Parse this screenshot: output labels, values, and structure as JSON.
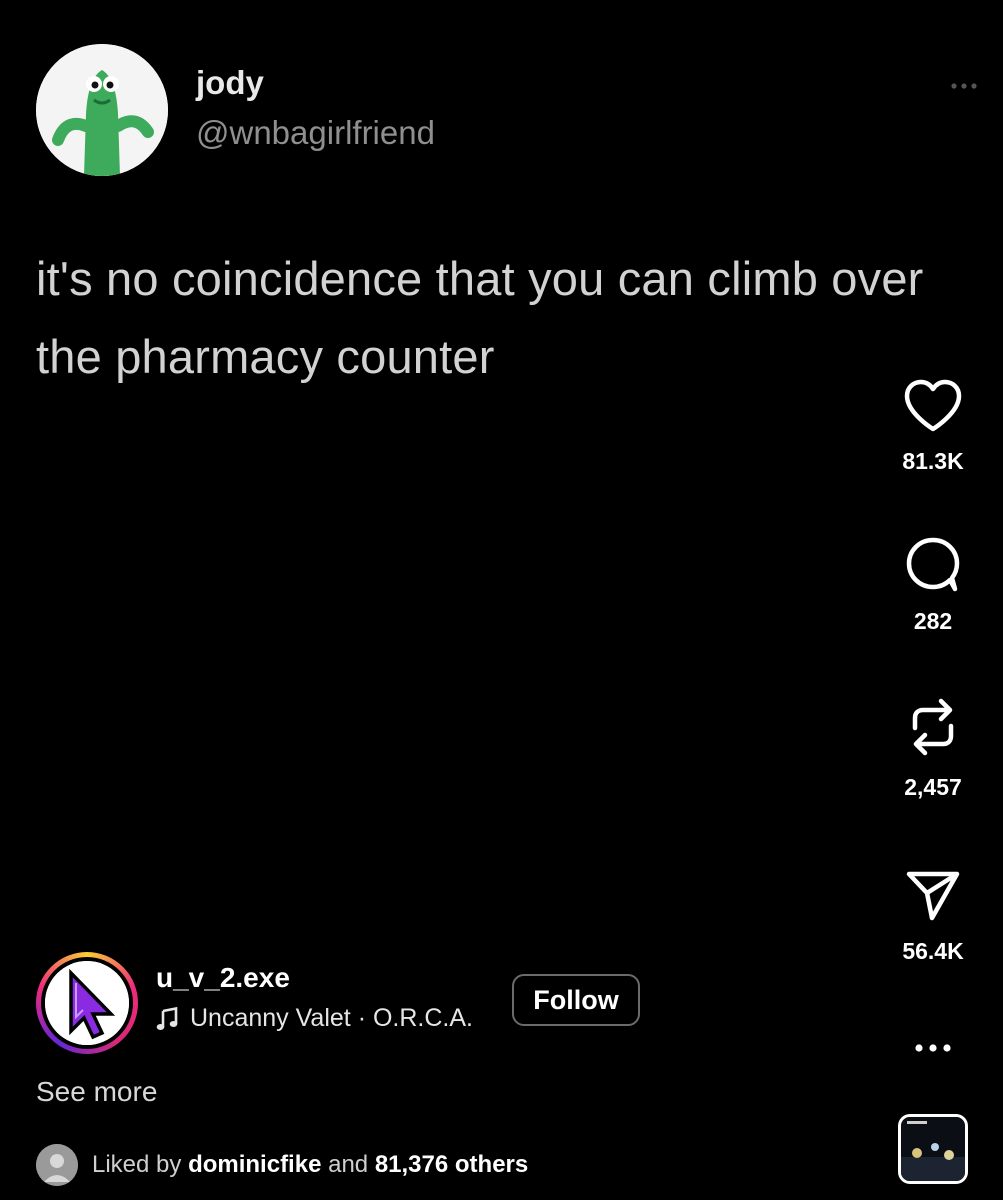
{
  "tweet": {
    "display_name": "jody",
    "handle": "@wnbagirlfriend",
    "text": "it's no coincidence that you can climb over the pharmacy counter",
    "avatar_icon": "green-tube-character-avatar",
    "more_icon": "ellipsis-icon"
  },
  "actions": {
    "like": {
      "icon": "heart-icon",
      "count": "81.3K"
    },
    "comment": {
      "icon": "comment-icon",
      "count": "282"
    },
    "repost": {
      "icon": "repost-icon",
      "count": "2,457"
    },
    "share": {
      "icon": "send-icon",
      "count": "56.4K"
    },
    "more": {
      "icon": "more-dots-icon"
    }
  },
  "creator": {
    "username": "u_v_2.exe",
    "audio_title": "Uncanny Valet · O.R.C.A.",
    "audio_icon": "music-note-icon",
    "follow_label": "Follow",
    "avatar_icon": "purple-cursor-avatar"
  },
  "caption": {
    "see_more_label": "See more"
  },
  "likes": {
    "prefix": "Liked by ",
    "user": "dominicfike",
    "middle": " and ",
    "others": "81,376 others"
  },
  "colors": {
    "background": "#000000",
    "story_ring_start": "#f9ce34",
    "story_ring_end": "#6228d7",
    "cursor_purple": "#8a2be2"
  }
}
